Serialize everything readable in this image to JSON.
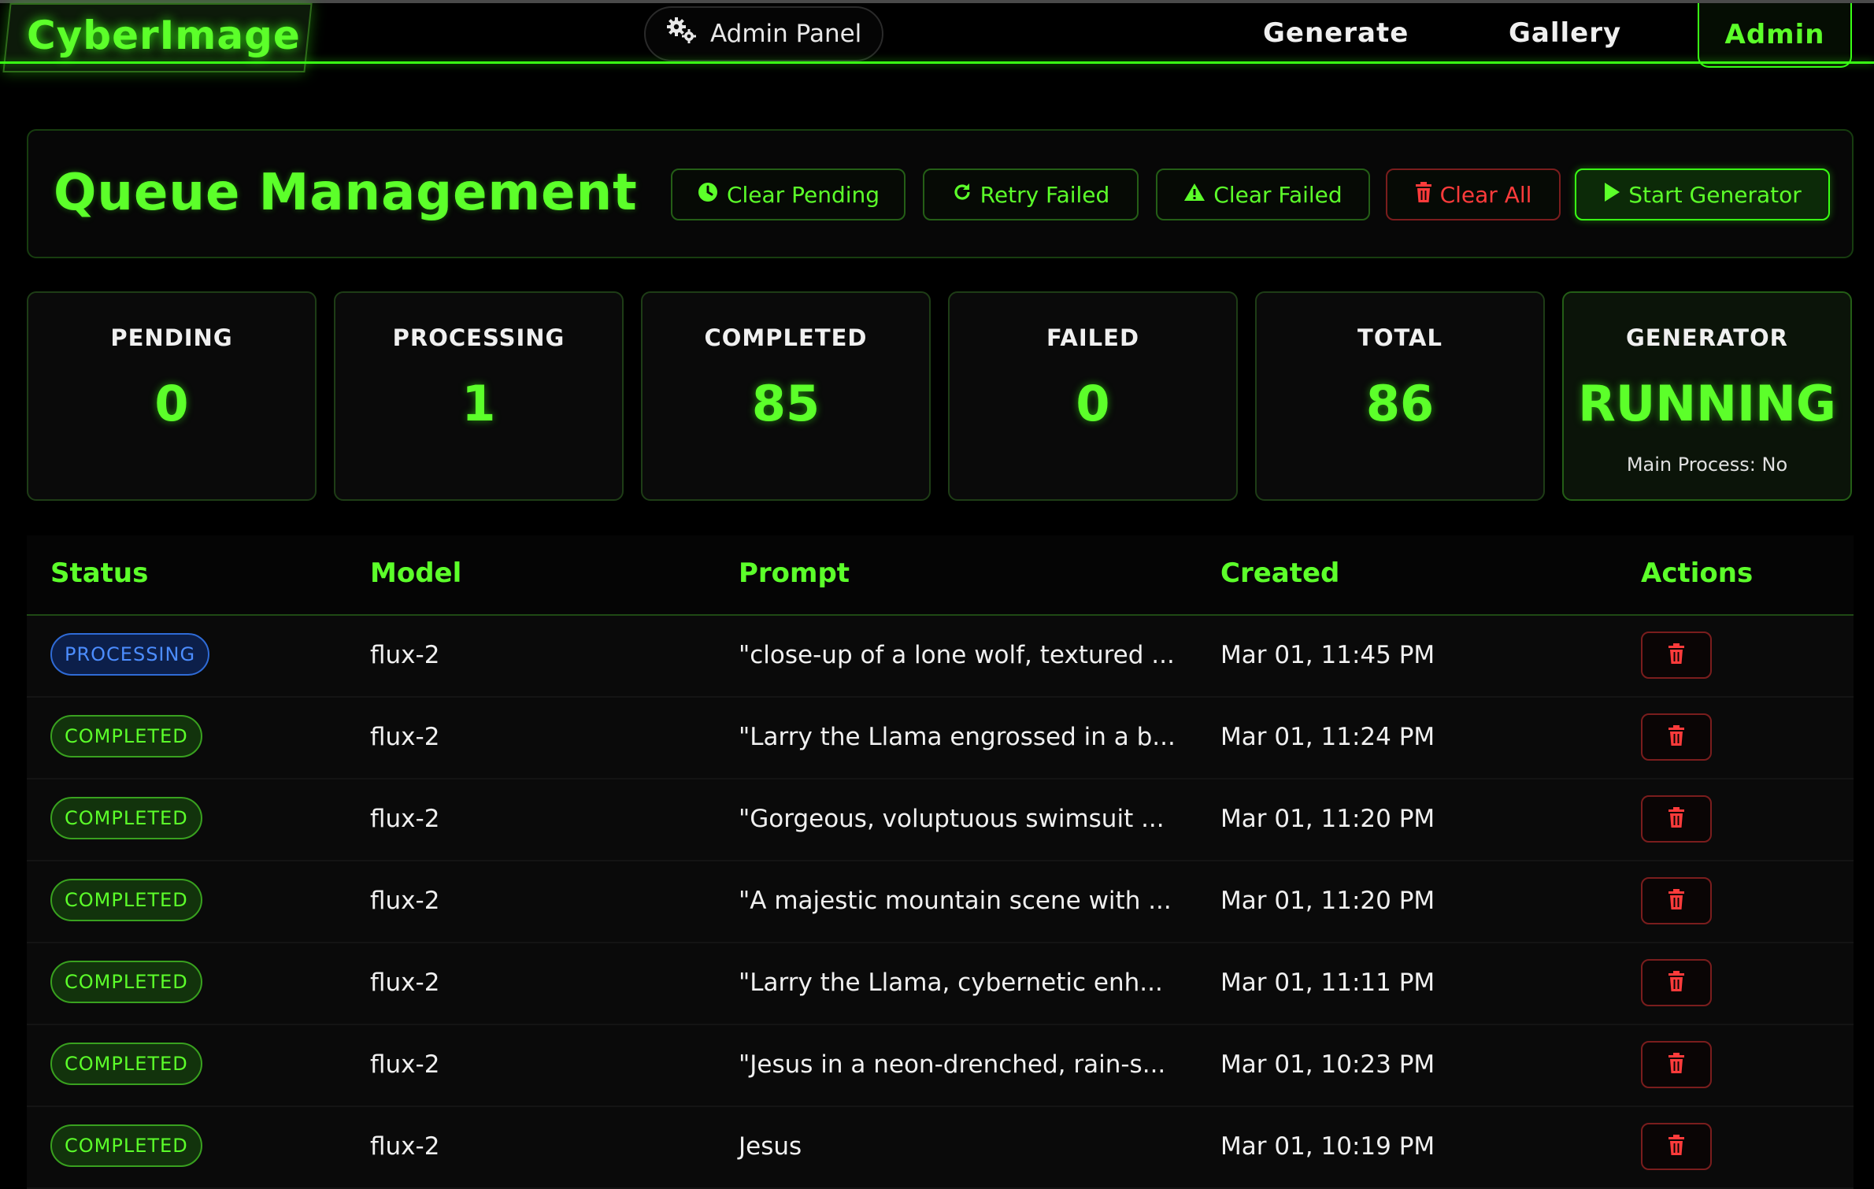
{
  "brand": "CyberImage",
  "nav": {
    "admin_panel": "Admin Panel",
    "generate": "Generate",
    "gallery": "Gallery",
    "admin": "Admin"
  },
  "queue": {
    "title": "Queue Management",
    "buttons": {
      "clear_pending": "Clear Pending",
      "retry_failed": "Retry Failed",
      "clear_failed": "Clear Failed",
      "clear_all": "Clear All",
      "start_generator": "Start Generator"
    }
  },
  "stats": {
    "pending": {
      "label": "PENDING",
      "value": "0"
    },
    "processing": {
      "label": "PROCESSING",
      "value": "1"
    },
    "completed": {
      "label": "COMPLETED",
      "value": "85"
    },
    "failed": {
      "label": "FAILED",
      "value": "0"
    },
    "total": {
      "label": "TOTAL",
      "value": "86"
    },
    "generator": {
      "label": "GENERATOR",
      "value": "RUNNING",
      "sub": "Main Process: No"
    }
  },
  "table": {
    "headers": [
      "Status",
      "Model",
      "Prompt",
      "Created",
      "Actions"
    ],
    "rows": [
      {
        "status": "PROCESSING",
        "model": "flux-2",
        "prompt": "\"close-up of a lone wolf, textured ...",
        "created": "Mar 01, 11:45 PM"
      },
      {
        "status": "COMPLETED",
        "model": "flux-2",
        "prompt": "\"Larry the Llama engrossed in a b...",
        "created": "Mar 01, 11:24 PM"
      },
      {
        "status": "COMPLETED",
        "model": "flux-2",
        "prompt": "\"Gorgeous, voluptuous swimsuit ...",
        "created": "Mar 01, 11:20 PM"
      },
      {
        "status": "COMPLETED",
        "model": "flux-2",
        "prompt": "\"A majestic mountain scene with ...",
        "created": "Mar 01, 11:20 PM"
      },
      {
        "status": "COMPLETED",
        "model": "flux-2",
        "prompt": "\"Larry the Llama, cybernetic enh...",
        "created": "Mar 01, 11:11 PM"
      },
      {
        "status": "COMPLETED",
        "model": "flux-2",
        "prompt": "\"Jesus in a neon-drenched, rain-s...",
        "created": "Mar 01, 10:23 PM"
      },
      {
        "status": "COMPLETED",
        "model": "flux-2",
        "prompt": "Jesus",
        "created": "Mar 01, 10:19 PM"
      }
    ]
  },
  "colors": {
    "accent": "#39ff14",
    "danger": "#ff3b3b",
    "processing": "#4c8dff"
  },
  "icons": {
    "admin_panel": "gears-icon",
    "clear_pending": "clock-icon",
    "retry_failed": "redo-icon",
    "clear_failed": "warning-icon",
    "clear_all": "trash-icon",
    "start_generator": "play-icon",
    "row_delete": "trash-icon"
  }
}
